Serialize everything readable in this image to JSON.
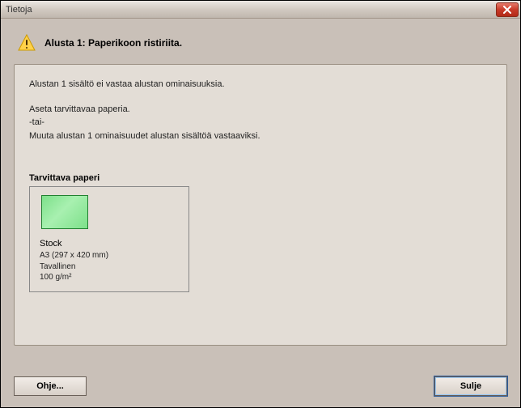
{
  "window": {
    "title": "Tietoja"
  },
  "header": {
    "text": "Alusta 1: Paperikoon ristiriita."
  },
  "message": {
    "line1": "Alustan 1 sisältö ei vastaa alustan ominaisuuksia.",
    "line2": "Aseta tarvittavaa paperia.",
    "line3": "-tai-",
    "line4": "Muuta alustan 1 ominaisuudet alustan sisältöä vastaaviksi."
  },
  "required_paper": {
    "section_label": "Tarvittava paperi",
    "name": "Stock",
    "size": "A3 (297 x 420 mm)",
    "type": "Tavallinen",
    "weight": "100 g/m²"
  },
  "buttons": {
    "help": "Ohje...",
    "close": "Sulje"
  }
}
